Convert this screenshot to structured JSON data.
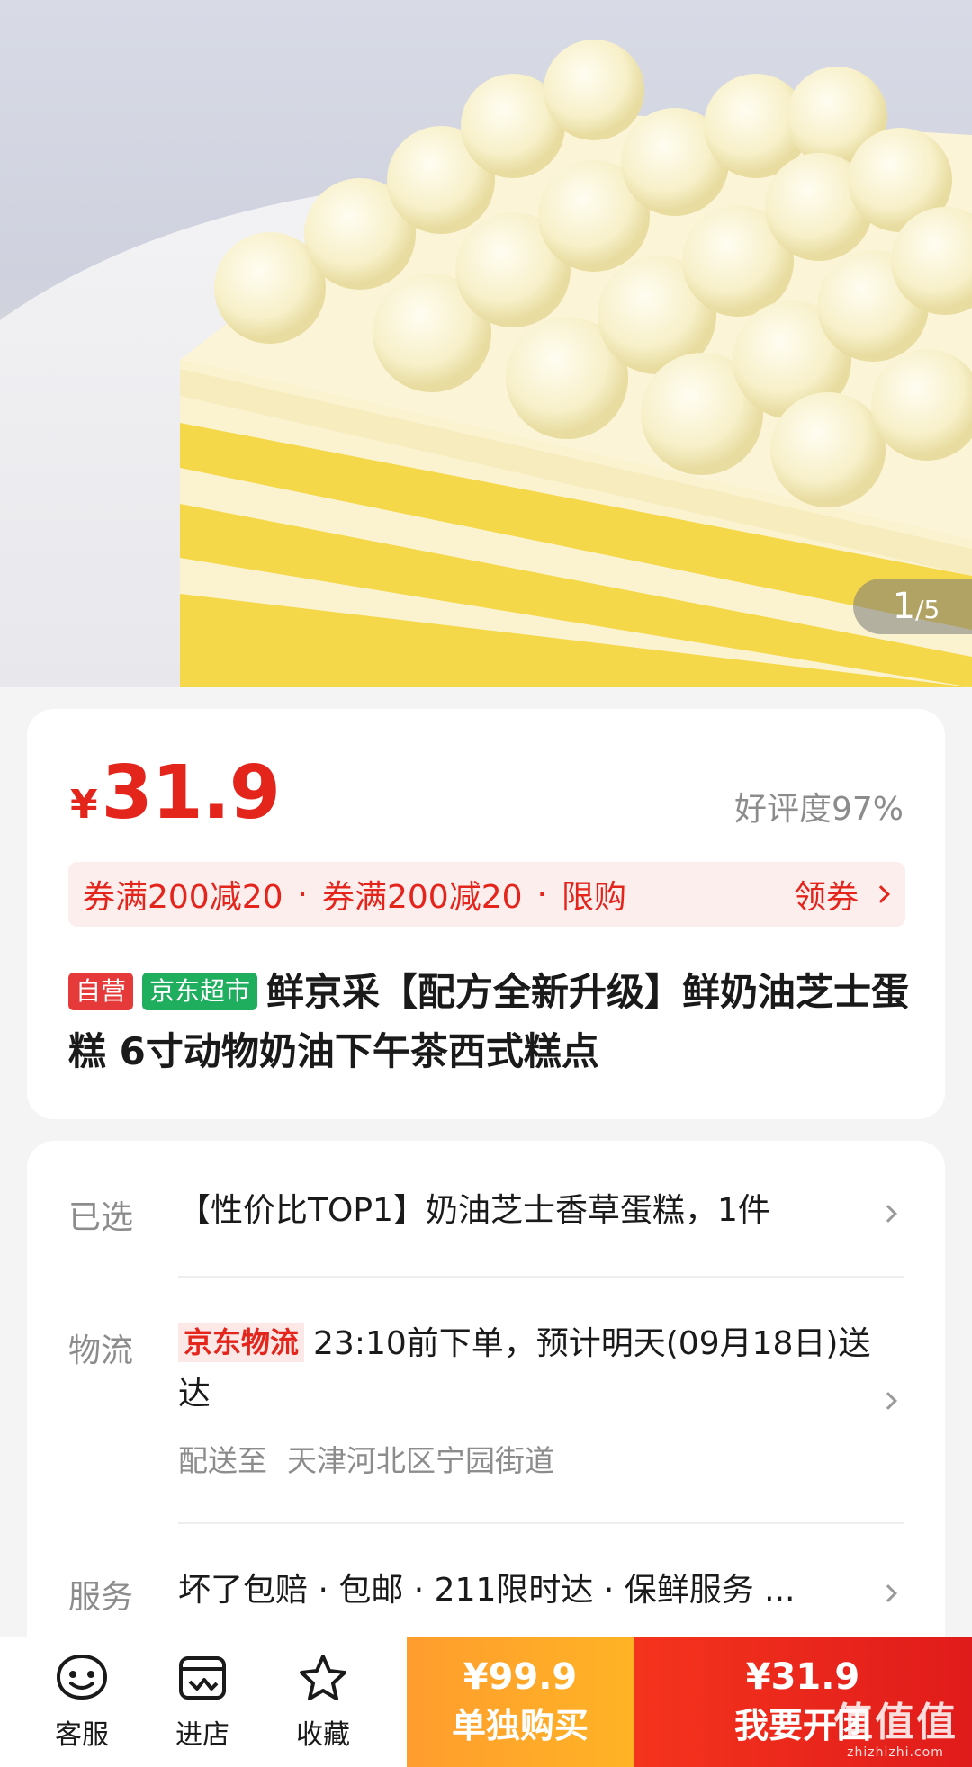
{
  "gallery": {
    "current": "1",
    "total": "/5"
  },
  "product": {
    "price_symbol": "¥",
    "price": "31.9",
    "rating": "好评度97%",
    "coupons": [
      "券满200减20",
      "券满200减20",
      "限购"
    ],
    "coupon_separator": "·",
    "get_coupon_label": "领券",
    "tag_self": "自营",
    "tag_store": "京东超市",
    "title": "鲜京采【配方全新升级】鲜奶油芝士蛋糕 6寸动物奶油下午茶西式糕点"
  },
  "details": {
    "selected_label": "已选",
    "selected_value": "【性价比TOP1】奶油芝士香草蛋糕，1件",
    "logistics_label": "物流",
    "logistics_badge": "京东物流",
    "logistics_text": "23:10前下单，预计明天(09月18日)送达",
    "delivery_prefix": "配送至",
    "delivery_address": "天津河北区宁园街道",
    "service_label": "服务",
    "service_text": "坏了包赔 · 包邮 · 211限时达 · 保鲜服务 ..."
  },
  "bottom_bar": {
    "nav": [
      {
        "label": "客服",
        "icon": "smile-face-icon"
      },
      {
        "label": "进店",
        "icon": "store-icon"
      },
      {
        "label": "收藏",
        "icon": "star-icon"
      }
    ],
    "single_price": "¥99.9",
    "single_label": "单独购买",
    "group_price": "¥31.9",
    "group_label": "我要开团"
  },
  "watermark": {
    "logo": "值值值",
    "url": "zhizhizhi.com"
  },
  "colors": {
    "accent_red": "#e3251c",
    "orange": "#ffa52a",
    "green_tag": "#1fad5e"
  }
}
